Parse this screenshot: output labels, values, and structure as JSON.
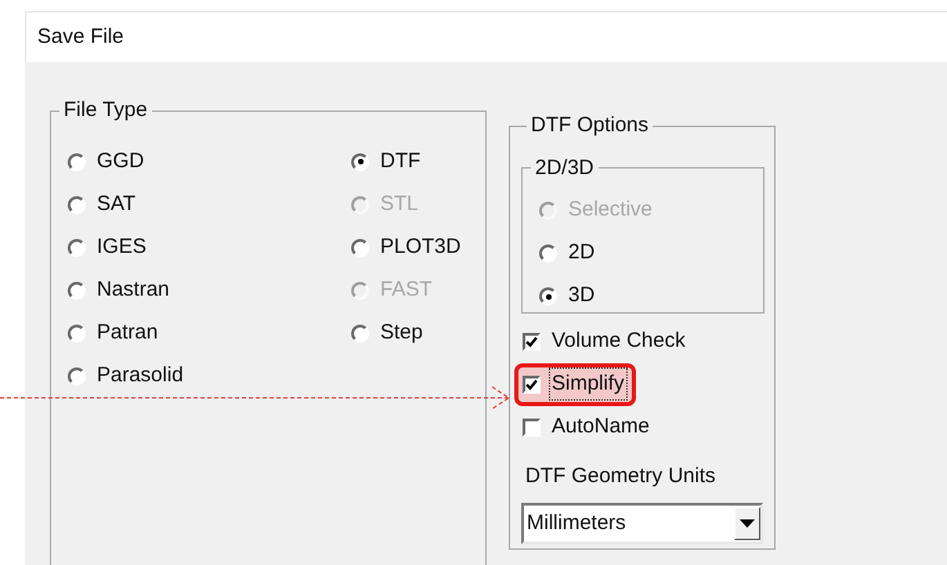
{
  "window": {
    "title": "Save File"
  },
  "file_type": {
    "label": "File Type",
    "columns": [
      [
        {
          "label": "GGD",
          "selected": false,
          "disabled": false
        },
        {
          "label": "SAT",
          "selected": false,
          "disabled": false
        },
        {
          "label": "IGES",
          "selected": false,
          "disabled": false
        },
        {
          "label": "Nastran",
          "selected": false,
          "disabled": false
        },
        {
          "label": "Patran",
          "selected": false,
          "disabled": false
        },
        {
          "label": "Parasolid",
          "selected": false,
          "disabled": false
        }
      ],
      [
        {
          "label": "DTF",
          "selected": true,
          "disabled": false
        },
        {
          "label": "STL",
          "selected": false,
          "disabled": true
        },
        {
          "label": "PLOT3D",
          "selected": false,
          "disabled": false
        },
        {
          "label": "FAST",
          "selected": false,
          "disabled": true
        },
        {
          "label": "Step",
          "selected": false,
          "disabled": false
        }
      ]
    ]
  },
  "dtf_options": {
    "label": "DTF Options",
    "dimension": {
      "label": "2D/3D",
      "options": [
        {
          "label": "Selective",
          "selected": false,
          "disabled": true
        },
        {
          "label": "2D",
          "selected": false,
          "disabled": false
        },
        {
          "label": "3D",
          "selected": true,
          "disabled": false
        }
      ]
    },
    "checkboxes": [
      {
        "label": "Volume Check",
        "checked": true,
        "focused": false,
        "highlighted": false
      },
      {
        "label": "Simplify",
        "checked": true,
        "focused": true,
        "highlighted": true
      },
      {
        "label": "AutoName",
        "checked": false,
        "focused": false,
        "highlighted": false
      }
    ],
    "units": {
      "label": "DTF Geometry Units",
      "value": "Millimeters"
    }
  }
}
